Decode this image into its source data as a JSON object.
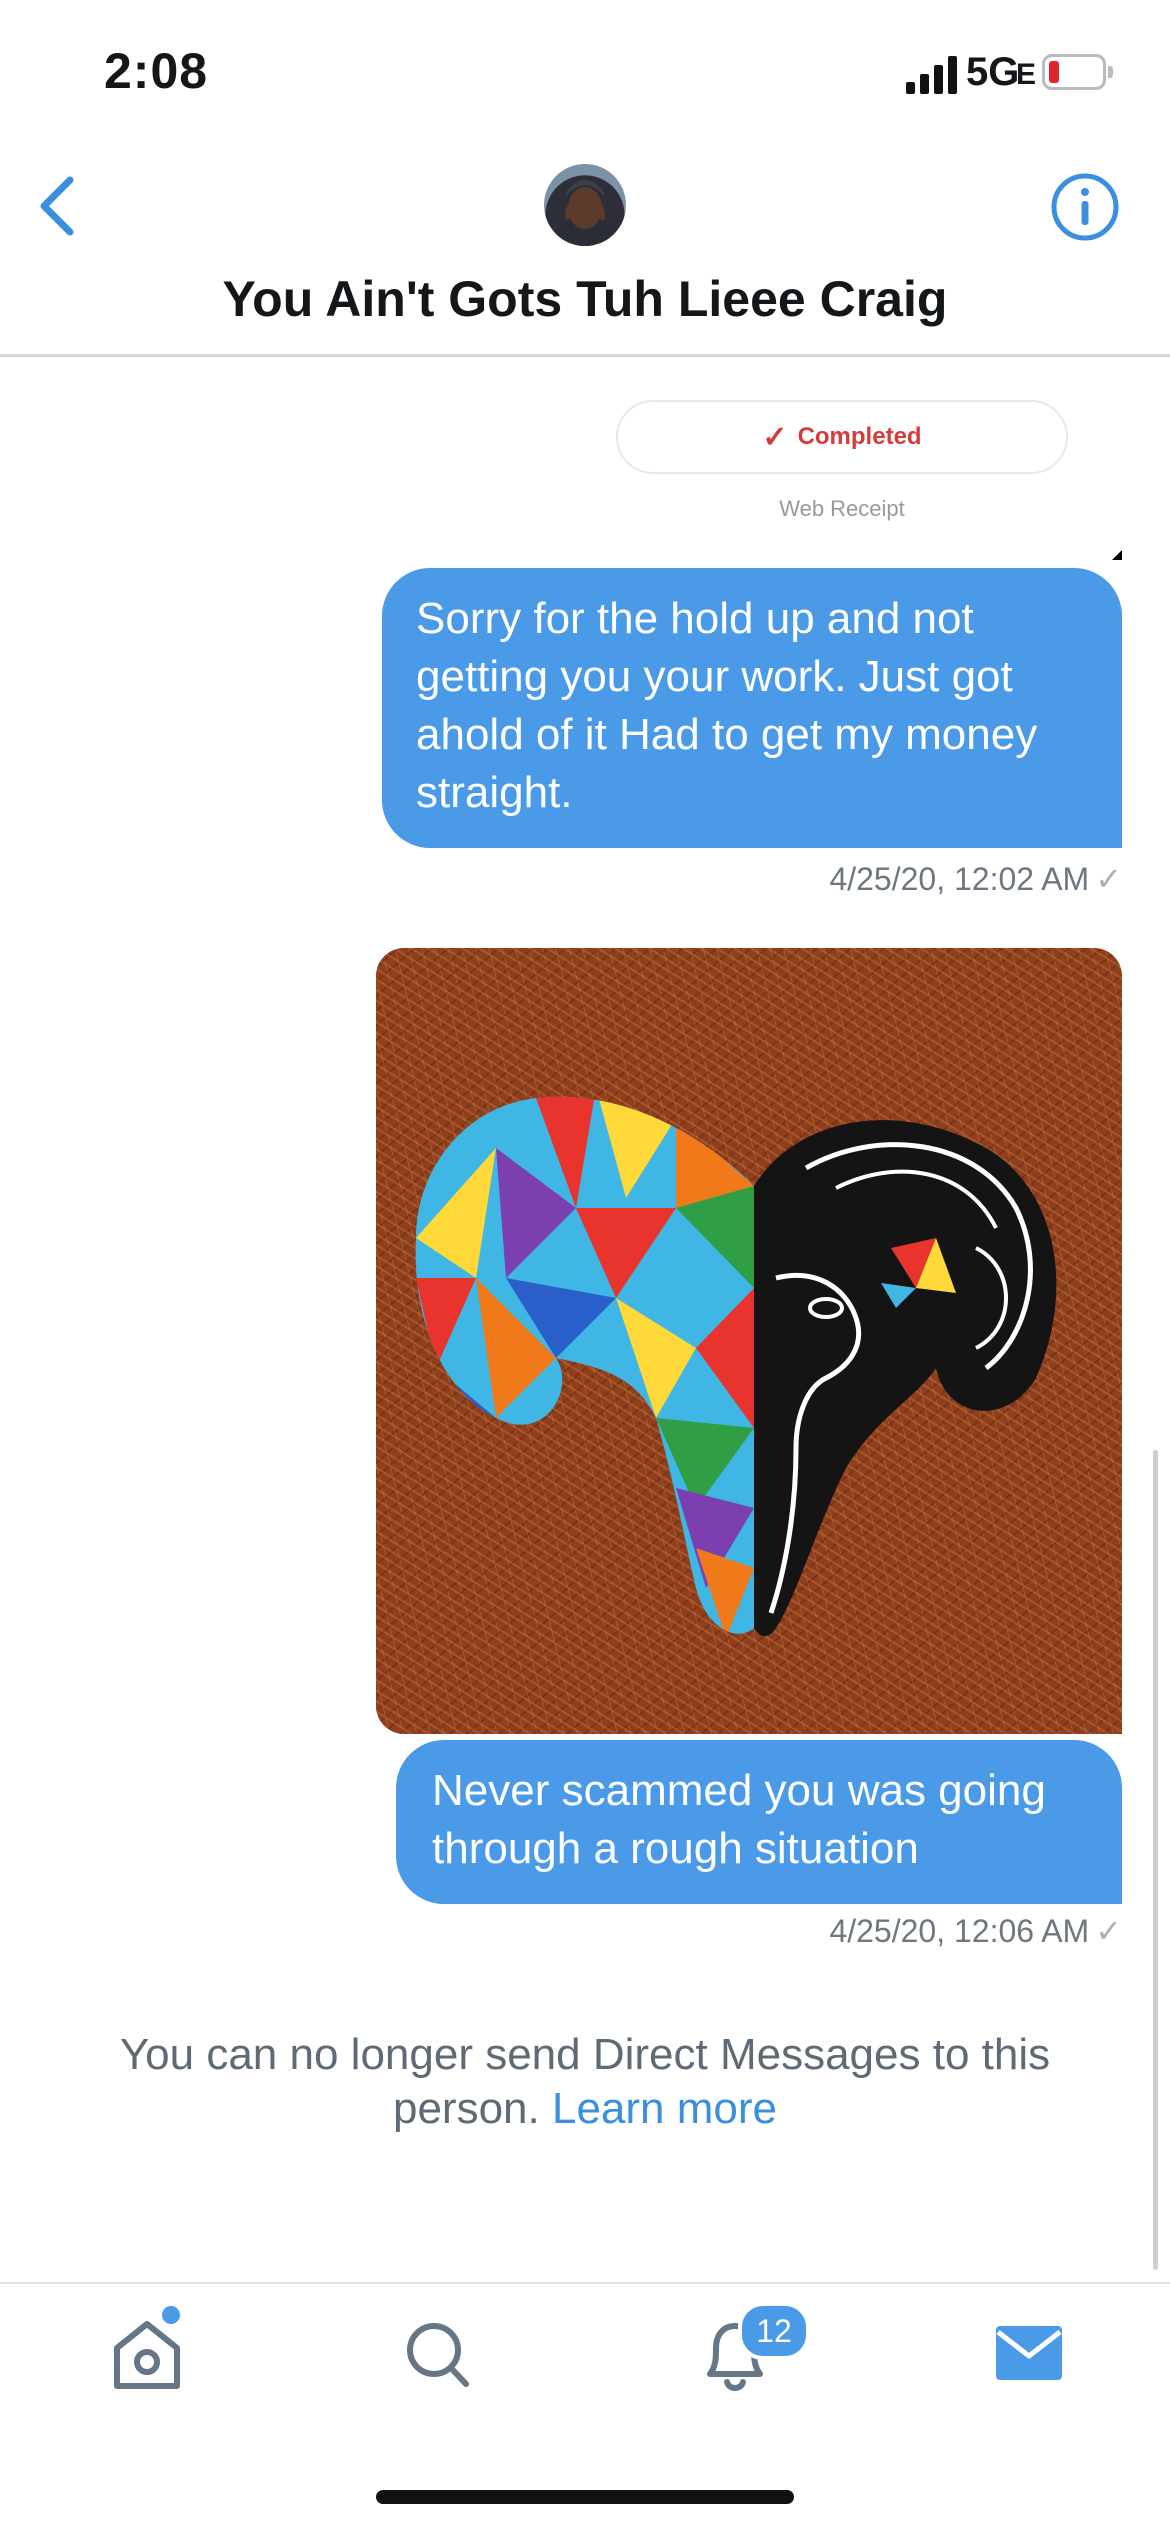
{
  "status_bar": {
    "time": "2:08",
    "network": "5G",
    "network_suffix": "E",
    "battery_level_percent": 10
  },
  "header": {
    "title": "You Ain't Gots Tuh Lieee Craig",
    "back_icon": "chevron-left-icon",
    "info_icon": "info-icon"
  },
  "receipt": {
    "status": "Completed",
    "label": "Web Receipt"
  },
  "messages": [
    {
      "text": "Sorry for the hold up and not getting you your work. Just got ahold of it Had to get my money straight.",
      "timestamp": "4/25/20, 12:02 AM"
    },
    {
      "type": "image",
      "description_icon": "ram-head-painting"
    },
    {
      "text": "Never scammed you was going through a rough situation",
      "timestamp": "4/25/20, 12:06 AM"
    }
  ],
  "notice": {
    "text": "You can no longer send Direct Messages to this person.",
    "link": "Learn more"
  },
  "tab_bar": {
    "tabs": [
      "home-icon",
      "search-icon",
      "bell-icon",
      "mail-icon"
    ],
    "notifications_badge": "12"
  },
  "colors": {
    "accent": "#4a9ae8",
    "link": "#3b8fe0",
    "receipt_status": "#d63b3b"
  }
}
